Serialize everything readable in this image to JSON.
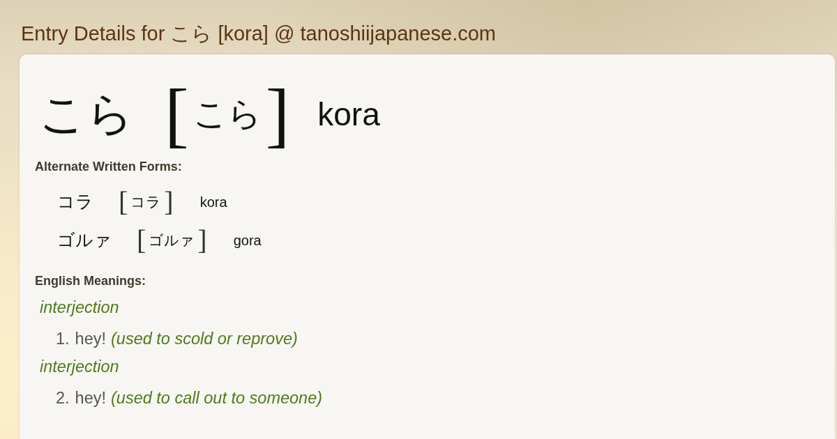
{
  "page_title": "Entry Details for こら [kora] @ tanoshiijapanese.com",
  "entry": {
    "written": "こら",
    "bracket_open": "[",
    "reading": "こら",
    "bracket_close": "]",
    "romaji": "kora"
  },
  "alternate_forms": {
    "heading": "Alternate Written Forms:",
    "forms": [
      {
        "written": "コラ",
        "bracket_open": "[",
        "reading": "コラ",
        "bracket_close": "]",
        "romaji": "kora"
      },
      {
        "written": "ゴルァ",
        "bracket_open": "[",
        "reading": "ゴルァ",
        "bracket_close": "]",
        "romaji": "gora"
      }
    ]
  },
  "meanings": {
    "heading": "English Meanings:",
    "senses": [
      {
        "part_of_speech": "interjection",
        "number": "1.",
        "gloss": "hey!",
        "note": "(used to scold or reprove)"
      },
      {
        "part_of_speech": "interjection",
        "number": "2.",
        "gloss": "hey!",
        "note": "(used to call out to someone)"
      }
    ]
  }
}
